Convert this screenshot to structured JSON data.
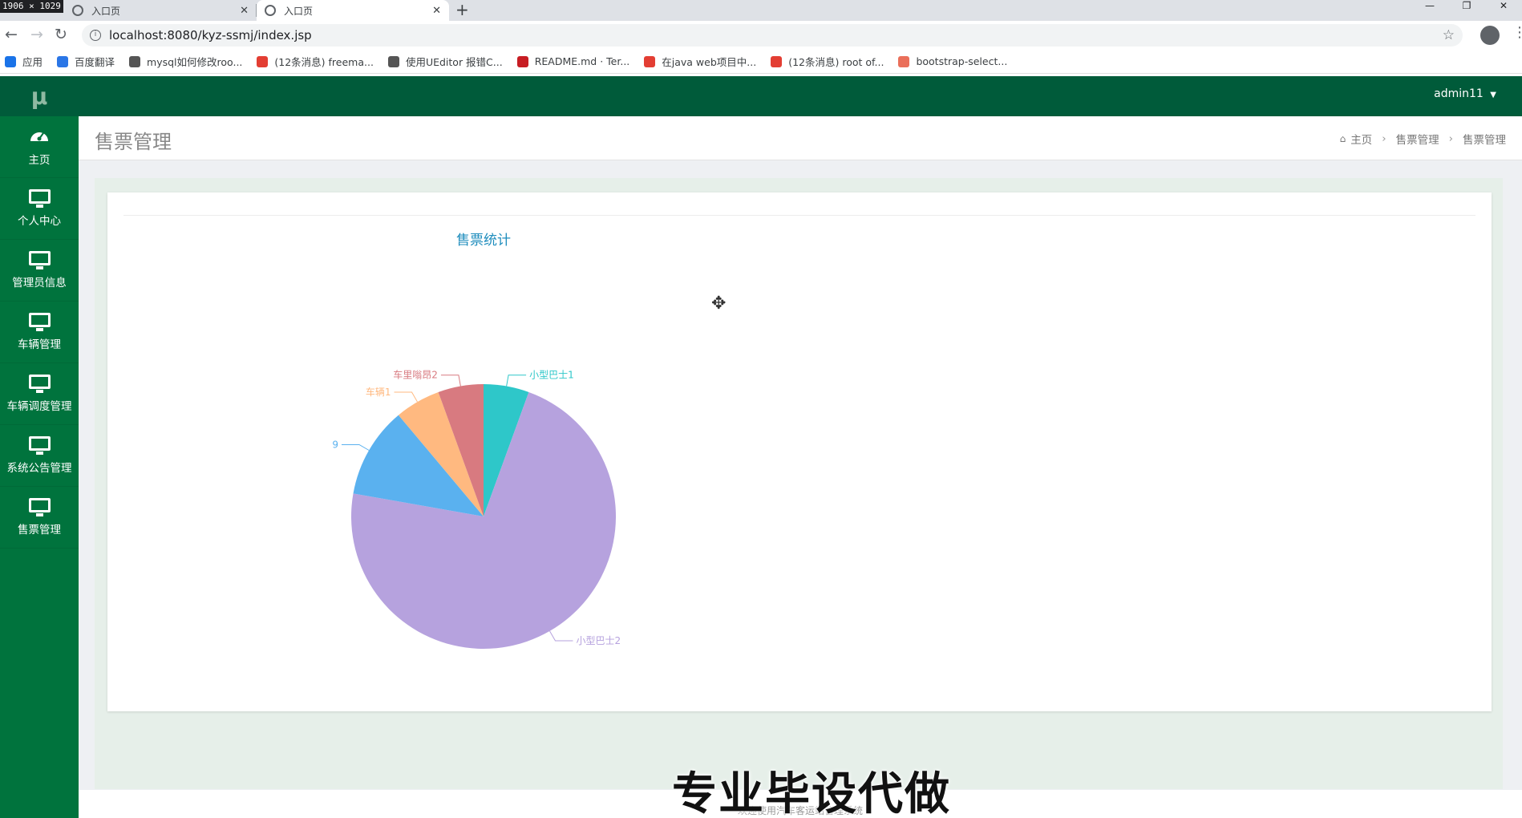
{
  "browser": {
    "dims_badge": "1906 × 1029",
    "tabs": [
      {
        "title": "入口页",
        "active": false
      },
      {
        "title": "入口页",
        "active": true
      }
    ],
    "url": "localhost:8080/kyz-ssmj/index.jsp",
    "bookmarks": [
      {
        "label": "应用",
        "icon": "apps-grid-icon",
        "color": "#1a73e8"
      },
      {
        "label": "百度翻译",
        "icon": "baidu-translate-icon",
        "color": "#2b76e6"
      },
      {
        "label": "mysql如何修改roo...",
        "icon": "bookmark-icon",
        "color": "#555555"
      },
      {
        "label": "(12条消息) freema...",
        "icon": "csdn-icon",
        "color": "#e33e33"
      },
      {
        "label": "使用UEditor 报错C...",
        "icon": "bookmark-icon",
        "color": "#555555"
      },
      {
        "label": "README.md · Ter...",
        "icon": "gitee-icon",
        "color": "#c71d23"
      },
      {
        "label": "在java web项目中...",
        "icon": "csdn-icon",
        "color": "#e33e33"
      },
      {
        "label": "(12条消息) root of...",
        "icon": "csdn-icon",
        "color": "#e33e33"
      },
      {
        "label": "bootstrap-select...",
        "icon": "jianshu-icon",
        "color": "#ea6f5a"
      }
    ]
  },
  "app": {
    "logo": "μ",
    "user": "admin11",
    "sidebar": [
      {
        "label": "主页",
        "icon": "dashboard-icon"
      },
      {
        "label": "个人中心",
        "icon": "monitor-icon"
      },
      {
        "label": "管理员信息",
        "icon": "monitor-icon"
      },
      {
        "label": "车辆管理",
        "icon": "monitor-icon"
      },
      {
        "label": "车辆调度管理",
        "icon": "monitor-icon"
      },
      {
        "label": "系统公告管理",
        "icon": "monitor-icon"
      },
      {
        "label": "售票管理",
        "icon": "monitor-icon"
      }
    ],
    "page_title": "售票管理",
    "breadcrumb": [
      "主页",
      "售票管理",
      "售票管理"
    ],
    "footer": "欢迎使用汽车客运站管理系统",
    "watermark": "专业毕设代做",
    "colors": {
      "sidebar": "#00733d",
      "topbar": "#005b3a",
      "title": "#1f8dbd"
    }
  },
  "chart_data": {
    "type": "pie",
    "title": "售票统计",
    "slices": [
      {
        "name": "小型巴士1",
        "value": 1,
        "color": "#2ec7c9"
      },
      {
        "name": "小型巴士2",
        "value": 13,
        "color": "#b6a2de"
      },
      {
        "name": "9",
        "value": 2,
        "color": "#5ab1ef"
      },
      {
        "name": "车辆1",
        "value": 1,
        "color": "#ffb980"
      },
      {
        "name": "车里嗡昂2",
        "value": 1,
        "color": "#d87a80"
      }
    ]
  }
}
